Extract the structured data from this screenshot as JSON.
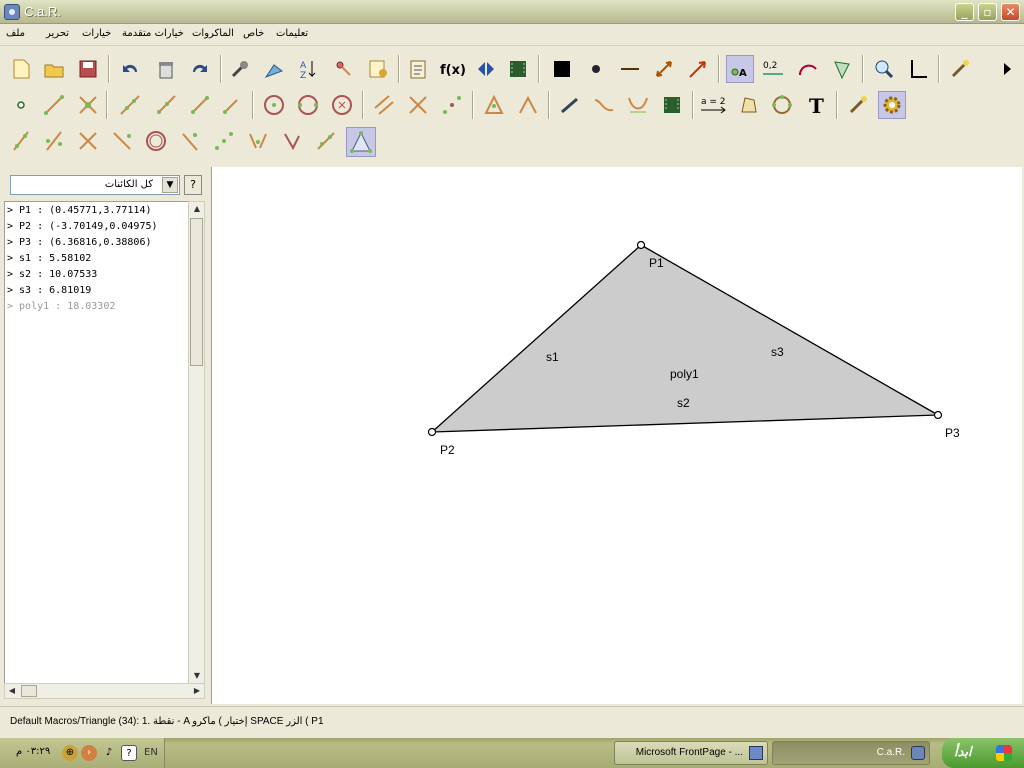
{
  "window": {
    "title": "C.a.R."
  },
  "menu": [
    "ملف",
    "تحرير",
    "خيارات",
    "خيارات متقدمة",
    "الماكروات",
    "خاص",
    "تعليمات"
  ],
  "side_panel": {
    "filter_value": "كل الكائنات",
    "help_label": "?",
    "objects": [
      "> P1 : (0.45771,3.77114)",
      "> P2 : (-3.70149,0.04975)",
      "> P3 : (6.36816,0.38806)",
      "> s1 : 5.58102",
      "> s2 : 10.07533",
      "> s3 : 6.81019",
      "> poly1 : 18.03302"
    ]
  },
  "canvas": {
    "fill_color": "#cccccc",
    "labels": {
      "P1": "P1",
      "P2": "P2",
      "P3": "P3",
      "s1": "s1",
      "s2": "s2",
      "s3": "s3",
      "poly1": "poly1"
    }
  },
  "status": {
    "text": "Default Macros/Triangle (34): 1. نقطة - A  إختيار  ) ماكرو SPACE الزر ( P1"
  },
  "taskbar": {
    "time": "٠٣:٢٩ م",
    "lang": "EN",
    "tasks": [
      "Microsoft FrontPage - ...",
      "C.a.R."
    ],
    "start": "ابدأ"
  }
}
